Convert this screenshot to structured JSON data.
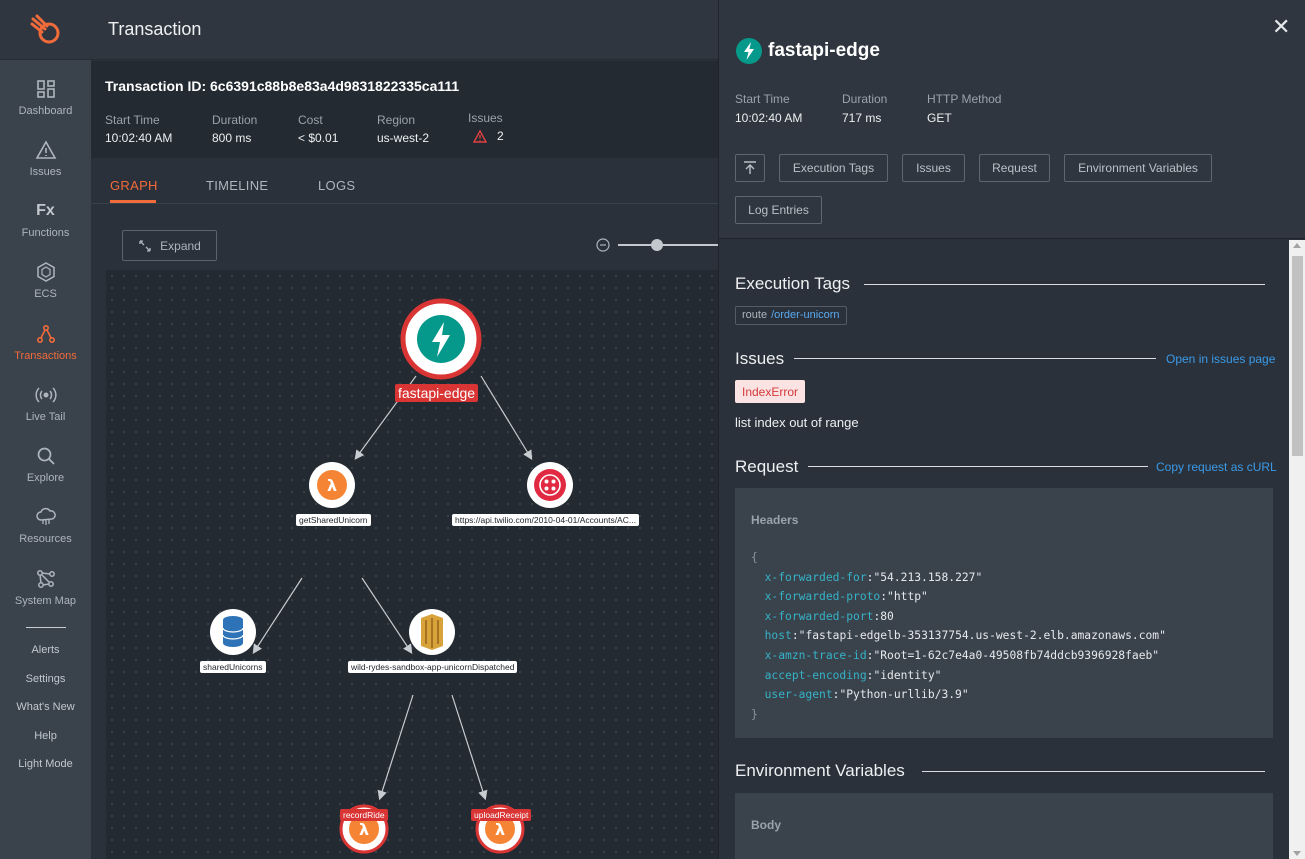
{
  "app": {
    "page_title": "Transaction"
  },
  "sidebar": {
    "items": [
      {
        "label": "Dashboard",
        "icon": "dashboard-icon"
      },
      {
        "label": "Issues",
        "icon": "warning-icon"
      },
      {
        "label": "Functions",
        "icon": "fx-icon"
      },
      {
        "label": "ECS",
        "icon": "hexagon-icon"
      },
      {
        "label": "Transactions",
        "icon": "transactions-icon",
        "active": true
      },
      {
        "label": "Live Tail",
        "icon": "broadcast-icon"
      },
      {
        "label": "Explore",
        "icon": "search-icon"
      },
      {
        "label": "Resources",
        "icon": "cloud-icon"
      },
      {
        "label": "System Map",
        "icon": "system-map-icon"
      }
    ],
    "links": [
      "Alerts",
      "Settings",
      "What's New",
      "Help",
      "Light Mode"
    ],
    "fx_glyph": "Fx"
  },
  "transaction": {
    "id_label": "Transaction ID: 6c6391c88b8e83a4d9831822335ca111",
    "start_time_label": "Start Time",
    "start_time": "10:02:40 AM",
    "duration_label": "Duration",
    "duration": "800 ms",
    "cost_label": "Cost",
    "cost": "< $0.01",
    "region_label": "Region",
    "region": "us-west-2",
    "issues_label": "Issues",
    "issues": "2"
  },
  "tabs": [
    "GRAPH",
    "TIMELINE",
    "LOGS"
  ],
  "graph": {
    "expand_label": "Expand",
    "nodes": {
      "root": "fastapi-edge",
      "get_shared": "getSharedUnicorn",
      "twilio": "https://api.twilio.com/2010-04-01/Accounts/AC...",
      "shared_unicorns": "sharedUnicorns",
      "dispatched": "wild-rydes-sandbox-app-unicornDispatched",
      "record_ride": "recordRide",
      "upload_receipt": "uploadReceipt"
    }
  },
  "panel": {
    "title": "fastapi-edge",
    "close": "✕",
    "start_time_label": "Start Time",
    "start_time": "10:02:40 AM",
    "duration_label": "Duration",
    "duration": "717 ms",
    "method_label": "HTTP Method",
    "method": "GET",
    "buttons": [
      "Execution Tags",
      "Issues",
      "Request",
      "Environment Variables",
      "Log Entries"
    ],
    "exec_tags_title": "Execution Tags",
    "tag_key": "route",
    "tag_value": "/order-unicorn",
    "issues_title": "Issues",
    "issues_link": "Open in issues page",
    "error_type": "IndexError",
    "error_message": "list index out of range",
    "request_title": "Request",
    "request_link": "Copy request as cURL",
    "headers_label": "Headers",
    "open_brace": "{",
    "close_brace": "}",
    "headers": [
      {
        "k": "x-forwarded-for",
        "v": "\"54.213.158.227\""
      },
      {
        "k": "x-forwarded-proto",
        "v": "\"http\""
      },
      {
        "k": "x-forwarded-port",
        "v": "80"
      },
      {
        "k": "host",
        "v": "\"fastapi-edgelb-353137754.us-west-2.elb.amazonaws.com\""
      },
      {
        "k": "x-amzn-trace-id",
        "v": "\"Root=1-62c7e4a0-49508fb74ddcb9396928faeb\""
      },
      {
        "k": "accept-encoding",
        "v": "\"identity\""
      },
      {
        "k": "user-agent",
        "v": "\"Python-urllib/3.9\""
      }
    ],
    "env_title": "Environment Variables",
    "body_label": "Body"
  },
  "colors": {
    "accent": "#f26b3a",
    "error": "#d93535",
    "link": "#3b9ae8",
    "fastapi_green": "#05998b",
    "lambda_orange": "#f58534"
  }
}
